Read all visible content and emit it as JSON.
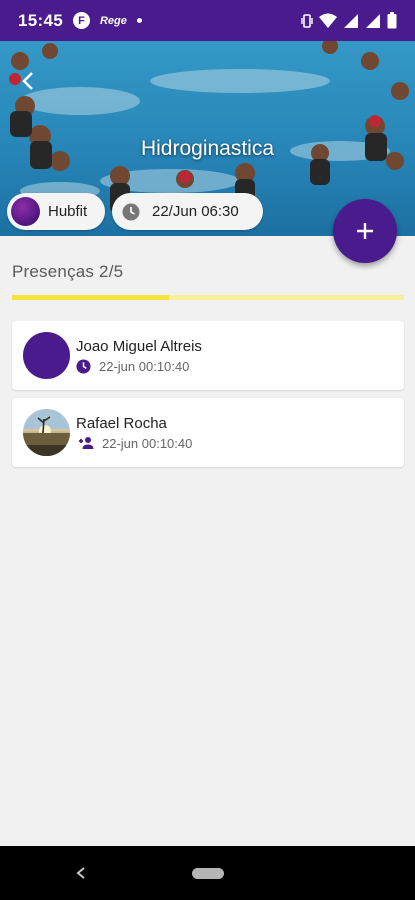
{
  "status_bar": {
    "time": "15:45",
    "app_icon_letter": "F",
    "app_icon_text": "Rege"
  },
  "hero": {
    "title": "Hidroginastica",
    "background_icon": "pool-photo"
  },
  "chips": {
    "gym_name": "Hubfit",
    "datetime": "22/Jun 06:30"
  },
  "presence": {
    "title": "Presenças 2/5",
    "progress_fraction": 0.4
  },
  "attendees": [
    {
      "name": "Joao Miguel Altreis",
      "time": "22-jun 00:10:40",
      "icon": "clock-icon"
    },
    {
      "name": "Rafael Rocha",
      "time": "22-jun 00:10:40",
      "icon": "person-add-icon"
    }
  ],
  "colors": {
    "primary": "#4a1b8c",
    "progress": "#f5e23a",
    "progress_track": "#f7ef9c"
  }
}
